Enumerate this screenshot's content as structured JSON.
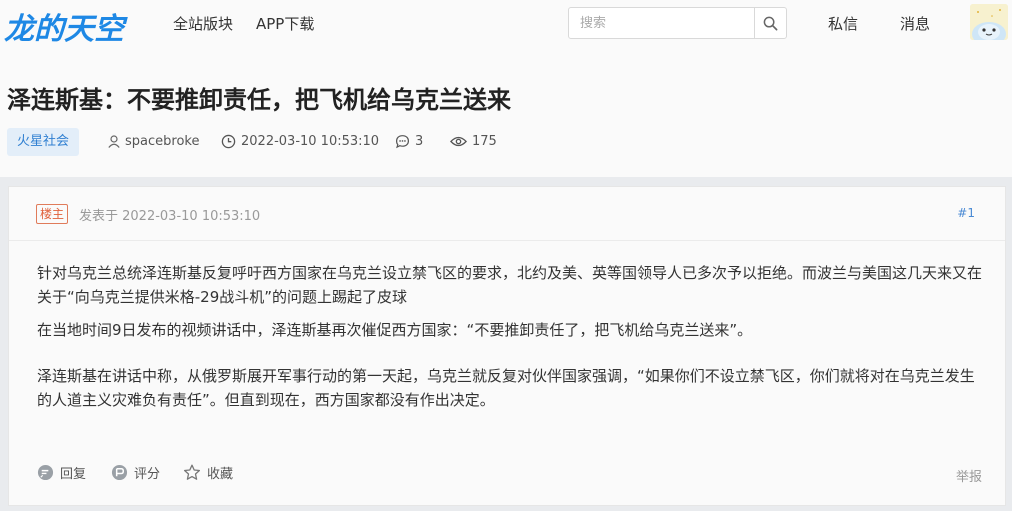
{
  "header": {
    "logo": "龙的天空",
    "nav": [
      "全站版块",
      "APP下载"
    ],
    "search_placeholder": "搜索",
    "messages": "私信",
    "notifications": "消息"
  },
  "thread": {
    "title": "泽连斯基：不要推卸责任，把飞机给乌克兰送来",
    "category": "火星社会",
    "author": "spacebroke",
    "datetime": "2022-03-10 10:53:10",
    "replies": "3",
    "views": "175"
  },
  "post": {
    "op_badge": "楼主",
    "posted_at": "发表于 2022-03-10 10:53:10",
    "floor": "#1",
    "paragraphs": [
      "针对乌克兰总统泽连斯基反复呼吁西方国家在乌克兰设立禁飞区的要求，北约及美、英等国领导人已多次予以拒绝。而波兰与美国这几天来又在关于“向乌克兰提供米格-29战斗机”的问题上踢起了皮球",
      "在当地时间9日发布的视频讲话中，泽连斯基再次催促西方国家：“不要推卸责任了，把飞机给乌克兰送来”。",
      "泽连斯基在讲话中称，从俄罗斯展开军事行动的第一天起，乌克兰就反复对伙伴国家强调，“如果你们不设立禁飞区，你们就将对在乌克兰发生的人道主义灾难负有责任”。但直到现在，西方国家都没有作出决定。"
    ],
    "actions": {
      "reply": "回复",
      "rate": "评分",
      "favorite": "收藏",
      "report": "举报"
    }
  },
  "colors": {
    "accent": "#1e88e5",
    "tag_bg": "#e3eef9",
    "op_badge": "#e0603a"
  }
}
